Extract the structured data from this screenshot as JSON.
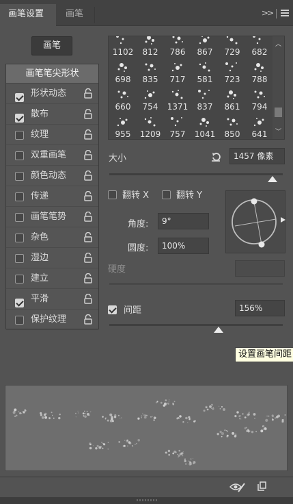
{
  "tabs": {
    "brush_settings": "画笔设置",
    "brush": "画笔",
    "collapse": ">>",
    "menu_icon": "menu-icon"
  },
  "brush_button": "画笔",
  "left_panel": {
    "tip_shape": "画笔笔尖形状",
    "options": [
      {
        "label": "形状动态",
        "checked": true
      },
      {
        "label": "散布",
        "checked": true
      },
      {
        "label": "纹理",
        "checked": false
      },
      {
        "label": "双重画笔",
        "checked": false
      },
      {
        "label": "颜色动态",
        "checked": false
      },
      {
        "label": "传递",
        "checked": false
      },
      {
        "label": "画笔笔势",
        "checked": false
      },
      {
        "label": "杂色",
        "checked": false
      },
      {
        "label": "湿边",
        "checked": false
      },
      {
        "label": "建立",
        "checked": false
      },
      {
        "label": "平滑",
        "checked": true
      },
      {
        "label": "保护纹理",
        "checked": false
      }
    ]
  },
  "brush_grid": {
    "rows": [
      [
        "1102",
        "812",
        "786",
        "867",
        "729",
        "682"
      ],
      [
        "698",
        "835",
        "717",
        "581",
        "723",
        "788"
      ],
      [
        "660",
        "754",
        "1371",
        "837",
        "861",
        "794"
      ],
      [
        "955",
        "1209",
        "757",
        "1041",
        "850",
        "641"
      ]
    ]
  },
  "size": {
    "label": "大小",
    "value": "1457 像素",
    "slider_fraction": 0.94
  },
  "flip": {
    "x_label": "翻转 X",
    "y_label": "翻转 Y",
    "x_checked": false,
    "y_checked": false
  },
  "angle": {
    "label": "角度:",
    "value": "9°"
  },
  "roundness": {
    "label": "圆度:",
    "value": "100%"
  },
  "hardness": {
    "label": "硬度",
    "value": ""
  },
  "spacing": {
    "label": "间距",
    "checked": true,
    "value": "156%",
    "slider_fraction": 0.63
  },
  "tooltip": "设置画笔间距",
  "footer": {
    "eye_icon": "eye-brush-icon",
    "new_icon": "new-preset-icon"
  },
  "colors": {
    "panel": "#535353",
    "tab_bar": "#424242",
    "highlight": "#6b6b6b",
    "tooltip_bg": "#ffffe1"
  }
}
